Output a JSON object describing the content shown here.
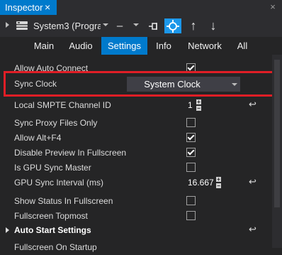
{
  "panel": {
    "title": "Inspector",
    "close_glyph": "×",
    "window_close_glyph": "×"
  },
  "toolbar": {
    "object_label": "System3 (Progra",
    "minus_glyph": "–",
    "pin_icon": "pin-icon",
    "target_icon": "crosshair-icon",
    "up_glyph": "↑",
    "down_glyph": "↓"
  },
  "tabs": [
    {
      "label": "Main",
      "selected": false
    },
    {
      "label": "Audio",
      "selected": false
    },
    {
      "label": "Settings",
      "selected": true
    },
    {
      "label": "Info",
      "selected": false
    },
    {
      "label": "Network",
      "selected": false
    },
    {
      "label": "All",
      "selected": false
    }
  ],
  "properties": {
    "allow_auto_connect": {
      "label": "Allow Auto Connect",
      "checked": true
    },
    "sync_clock": {
      "label": "Sync Clock",
      "value": "System Clock"
    },
    "local_smpte": {
      "label": "Local SMPTE Channel ID",
      "value": "1",
      "reset_glyph": "↩"
    },
    "sync_proxy": {
      "label": "Sync Proxy Files Only",
      "checked": false
    },
    "allow_alt_f4": {
      "label": "Allow Alt+F4",
      "checked": true
    },
    "disable_preview": {
      "label": "Disable Preview In Fullscreen",
      "checked": true
    },
    "gpu_sync_master": {
      "label": "Is GPU Sync Master",
      "checked": false
    },
    "gpu_sync_interval": {
      "label": "GPU Sync Interval (ms)",
      "value": "16.667",
      "reset_glyph": "↩"
    },
    "show_status": {
      "label": "Show Status In Fullscreen",
      "checked": false
    },
    "fullscreen_topmost": {
      "label": "Fullscreen Topmost",
      "checked": false
    },
    "auto_start_group": {
      "label": "Auto Start Settings",
      "reset_glyph": "↩"
    },
    "fullscreen_startup": {
      "label": "Fullscreen On Startup"
    }
  },
  "colors": {
    "accent": "#007acc",
    "highlight_frame": "#e01e26",
    "background": "#252526"
  }
}
